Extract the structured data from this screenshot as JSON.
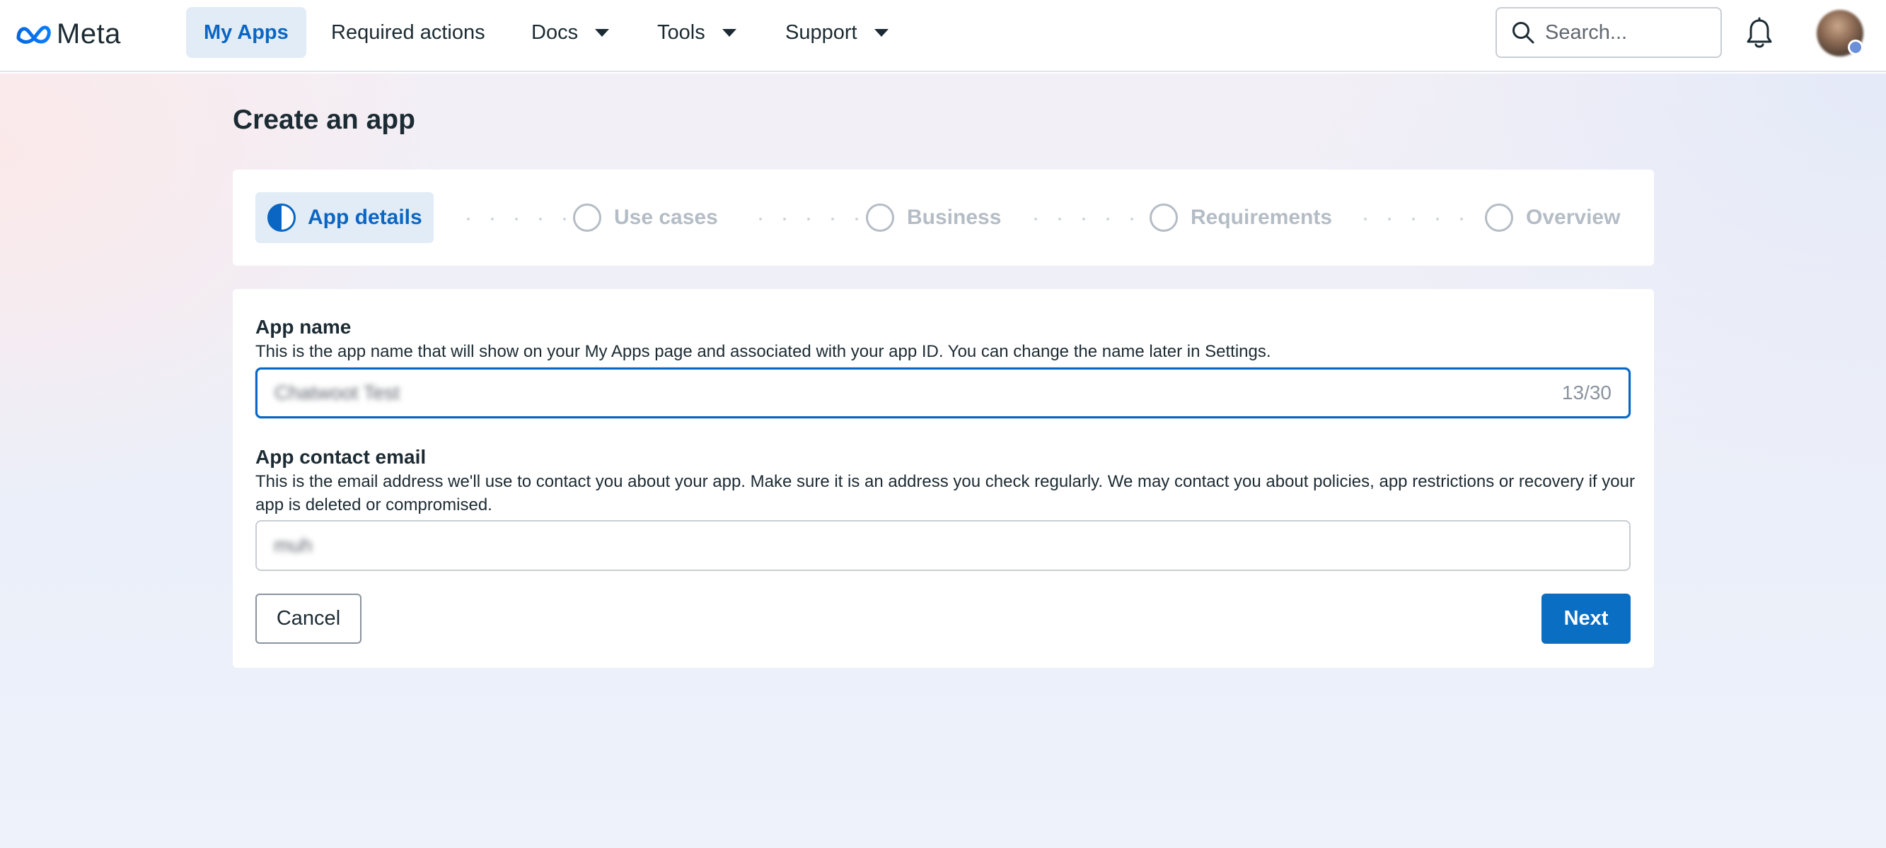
{
  "brand": {
    "name": "Meta",
    "icon": "meta-infinity-logo"
  },
  "nav": {
    "items": [
      {
        "label": "My Apps",
        "active": true,
        "dropdown": false
      },
      {
        "label": "Required actions",
        "active": false,
        "dropdown": false
      },
      {
        "label": "Docs",
        "active": false,
        "dropdown": true
      },
      {
        "label": "Tools",
        "active": false,
        "dropdown": true
      },
      {
        "label": "Support",
        "active": false,
        "dropdown": true
      }
    ]
  },
  "search": {
    "placeholder": "Search...",
    "value": ""
  },
  "header_icons": [
    "search-icon",
    "bell-icon",
    "avatar"
  ],
  "page": {
    "title": "Create an app"
  },
  "stepper": {
    "steps": [
      {
        "label": "App details",
        "state": "current"
      },
      {
        "label": "Use cases",
        "state": "upcoming"
      },
      {
        "label": "Business",
        "state": "upcoming"
      },
      {
        "label": "Requirements",
        "state": "upcoming"
      },
      {
        "label": "Overview",
        "state": "upcoming"
      }
    ]
  },
  "form": {
    "app_name": {
      "label": "App name",
      "help": "This is the app name that will show on your My Apps page and associated with your app ID. You can change the name later in Settings.",
      "value": "Chatwoot Test",
      "counter": "13/30"
    },
    "app_contact_email": {
      "label": "App contact email",
      "help": "This is the email address we'll use to contact you about your app. Make sure it is an address you check regularly. We may contact you about policies, app restrictions or recovery if your app is deleted or compromised.",
      "value": "muh"
    }
  },
  "actions": {
    "cancel_label": "Cancel",
    "next_label": "Next"
  },
  "colors": {
    "accent": "#0a66c2",
    "button_primary": "#0a6ec2",
    "active_nav_bg": "#e2ecf6",
    "text_primary": "#1c2b33",
    "step_inactive": "#b4bcc5"
  }
}
